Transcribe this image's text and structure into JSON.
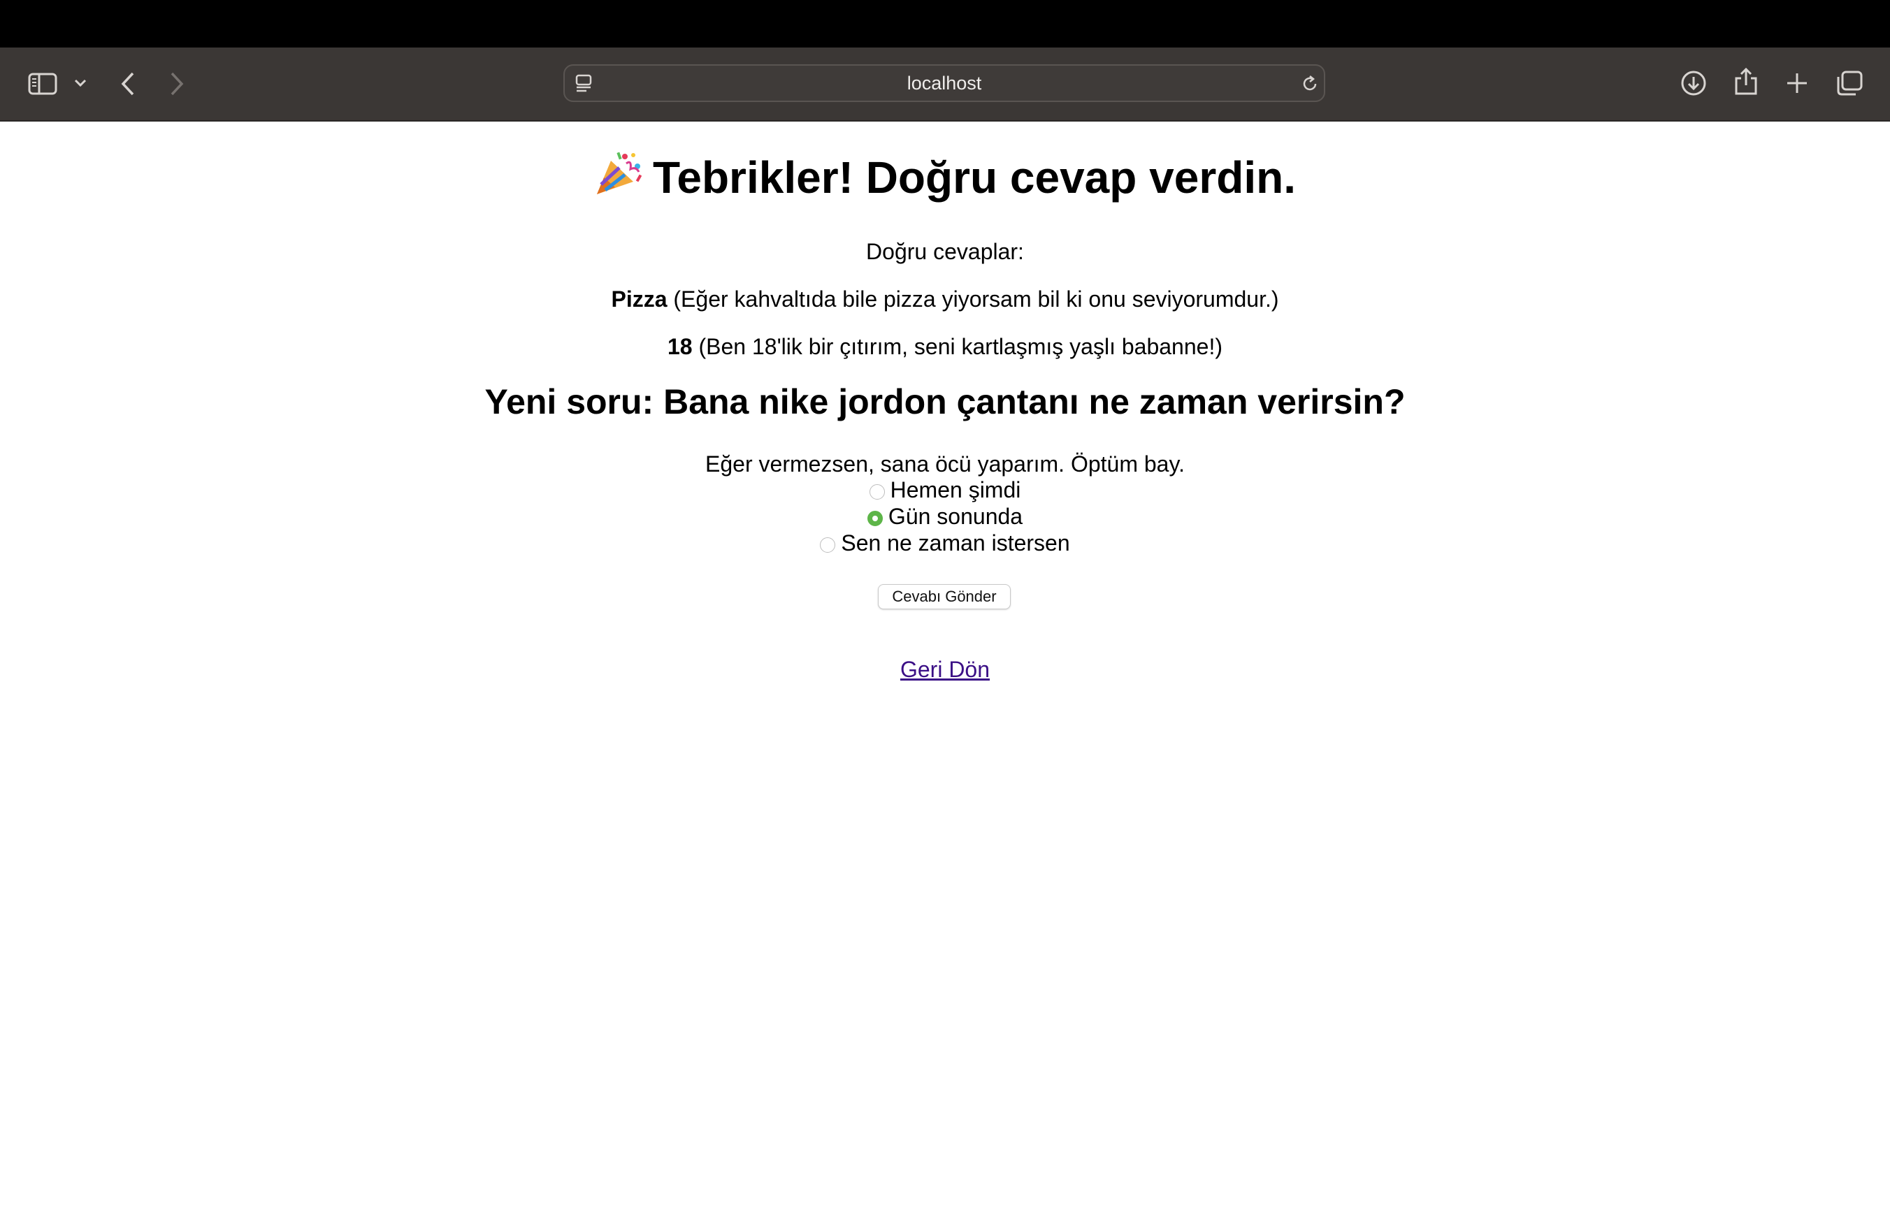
{
  "browser": {
    "url": "localhost",
    "icons": {
      "sidebar": "sidebar-icon",
      "sidebar_menu": "chevron-down-icon",
      "back": "chevron-left-icon",
      "forward": "chevron-right-icon",
      "reader": "reader-icon",
      "reload": "reload-icon",
      "downloads": "download-icon",
      "share": "share-icon",
      "new_tab": "plus-icon",
      "tabs": "tabs-overview-icon"
    }
  },
  "page": {
    "title_emoji": "party-popper-icon",
    "title": "Tebrikler! Doğru cevap verdin.",
    "correct_heading": "Doğru cevaplar:",
    "answers": [
      {
        "bold": "Pizza",
        "text": " (Eğer kahvaltıda bile pizza yiyorsam bil ki onu seviyorumdur.)"
      },
      {
        "bold": "18",
        "text": " (Ben 18'lik bir çıtırım, seni kartlaşmış yaşlı babanne!)"
      }
    ],
    "question": "Yeni soru: Bana nike jordon çantanı ne zaman verirsin?",
    "question_note": "Eğer vermezsen, sana öcü yaparım. Öptüm bay.",
    "options": [
      {
        "label": "Hemen şimdi",
        "checked": false
      },
      {
        "label": "Gün sonunda",
        "checked": true
      },
      {
        "label": "Sen ne zaman istersen",
        "checked": false
      }
    ],
    "submit_label": "Cevabı Gönder",
    "back_link": "Geri Dön"
  },
  "colors": {
    "toolbar": "#3b3735",
    "radio_checked": "#5db548",
    "link_visited": "#3b0f86"
  }
}
